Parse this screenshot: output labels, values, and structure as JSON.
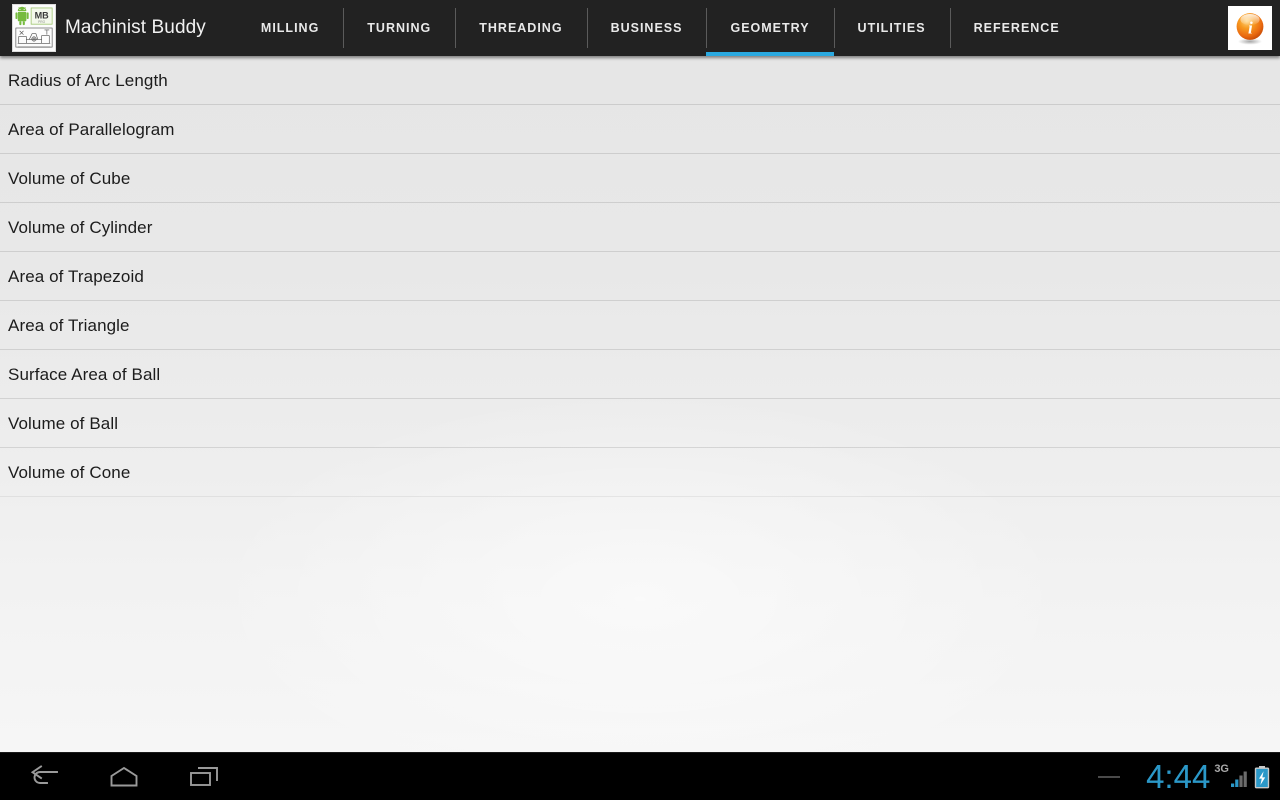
{
  "app": {
    "title": "Machinist Buddy",
    "icon_name": "machinist-buddy-app-icon",
    "accent_color": "#2aa9e0",
    "action_bar_color": "#222222"
  },
  "tabs": [
    {
      "label": "MILLING",
      "active": false
    },
    {
      "label": "TURNING",
      "active": false
    },
    {
      "label": "THREADING",
      "active": false
    },
    {
      "label": "BUSINESS",
      "active": false
    },
    {
      "label": "GEOMETRY",
      "active": true
    },
    {
      "label": "UTILITIES",
      "active": false
    },
    {
      "label": "REFERENCE",
      "active": false
    }
  ],
  "action_bar": {
    "info_button_label": "info-icon"
  },
  "list": {
    "items": [
      {
        "label": "Radius of Arc Length"
      },
      {
        "label": "Area of Parallelogram"
      },
      {
        "label": "Volume of Cube"
      },
      {
        "label": "Volume of Cylinder"
      },
      {
        "label": "Area of Trapezoid"
      },
      {
        "label": "Area of Triangle"
      },
      {
        "label": "Surface Area of Ball"
      },
      {
        "label": "Volume of Ball"
      },
      {
        "label": "Volume of Cone"
      }
    ]
  },
  "nav_bar": {
    "back_label": "back-icon",
    "home_label": "home-icon",
    "recents_label": "recent-apps-icon"
  },
  "status_bar": {
    "clock": "4:44",
    "network_type": "3G",
    "signal_bars_filled": 2,
    "signal_bars_total": 4,
    "battery_state": "charging",
    "clock_color": "#2b98c8"
  }
}
